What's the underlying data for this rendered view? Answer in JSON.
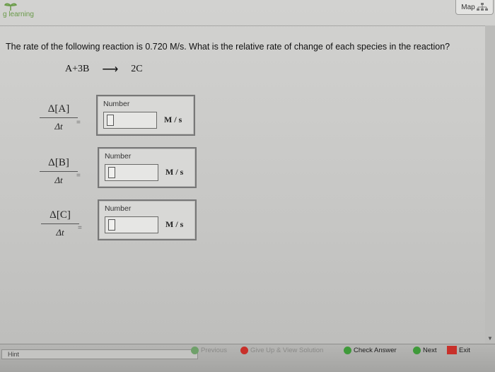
{
  "app": {
    "logo_text": "g learning",
    "map_label": "Map"
  },
  "question": {
    "text": "The rate of the following reaction is 0.720 M/s. What is the relative rate of change of each species in the reaction?",
    "reaction": {
      "left": "A+3B",
      "arrow": "⟶",
      "right": "2C"
    }
  },
  "rows": [
    {
      "numerator": "Δ[A]",
      "denominator": "Δt",
      "equals": "=",
      "box_label": "Number",
      "value": "",
      "unit": "M / s"
    },
    {
      "numerator": "Δ[B]",
      "denominator": "Δt",
      "equals": "=",
      "box_label": "Number",
      "value": "",
      "unit": "M / s"
    },
    {
      "numerator": "Δ[C]",
      "denominator": "Δt",
      "equals": "=",
      "box_label": "Number",
      "value": "",
      "unit": "M / s"
    }
  ],
  "footer": {
    "hint": "Hint",
    "previous": "Previous",
    "give_up": "Give Up & View Solution",
    "check_answer": "Check Answer",
    "next": "Next",
    "exit": "Exit"
  },
  "colors": {
    "check_green": "#3f9a3a",
    "give_up_red": "#c8302a",
    "next_green": "#3f9a3a",
    "exit_red": "#c8302a"
  }
}
